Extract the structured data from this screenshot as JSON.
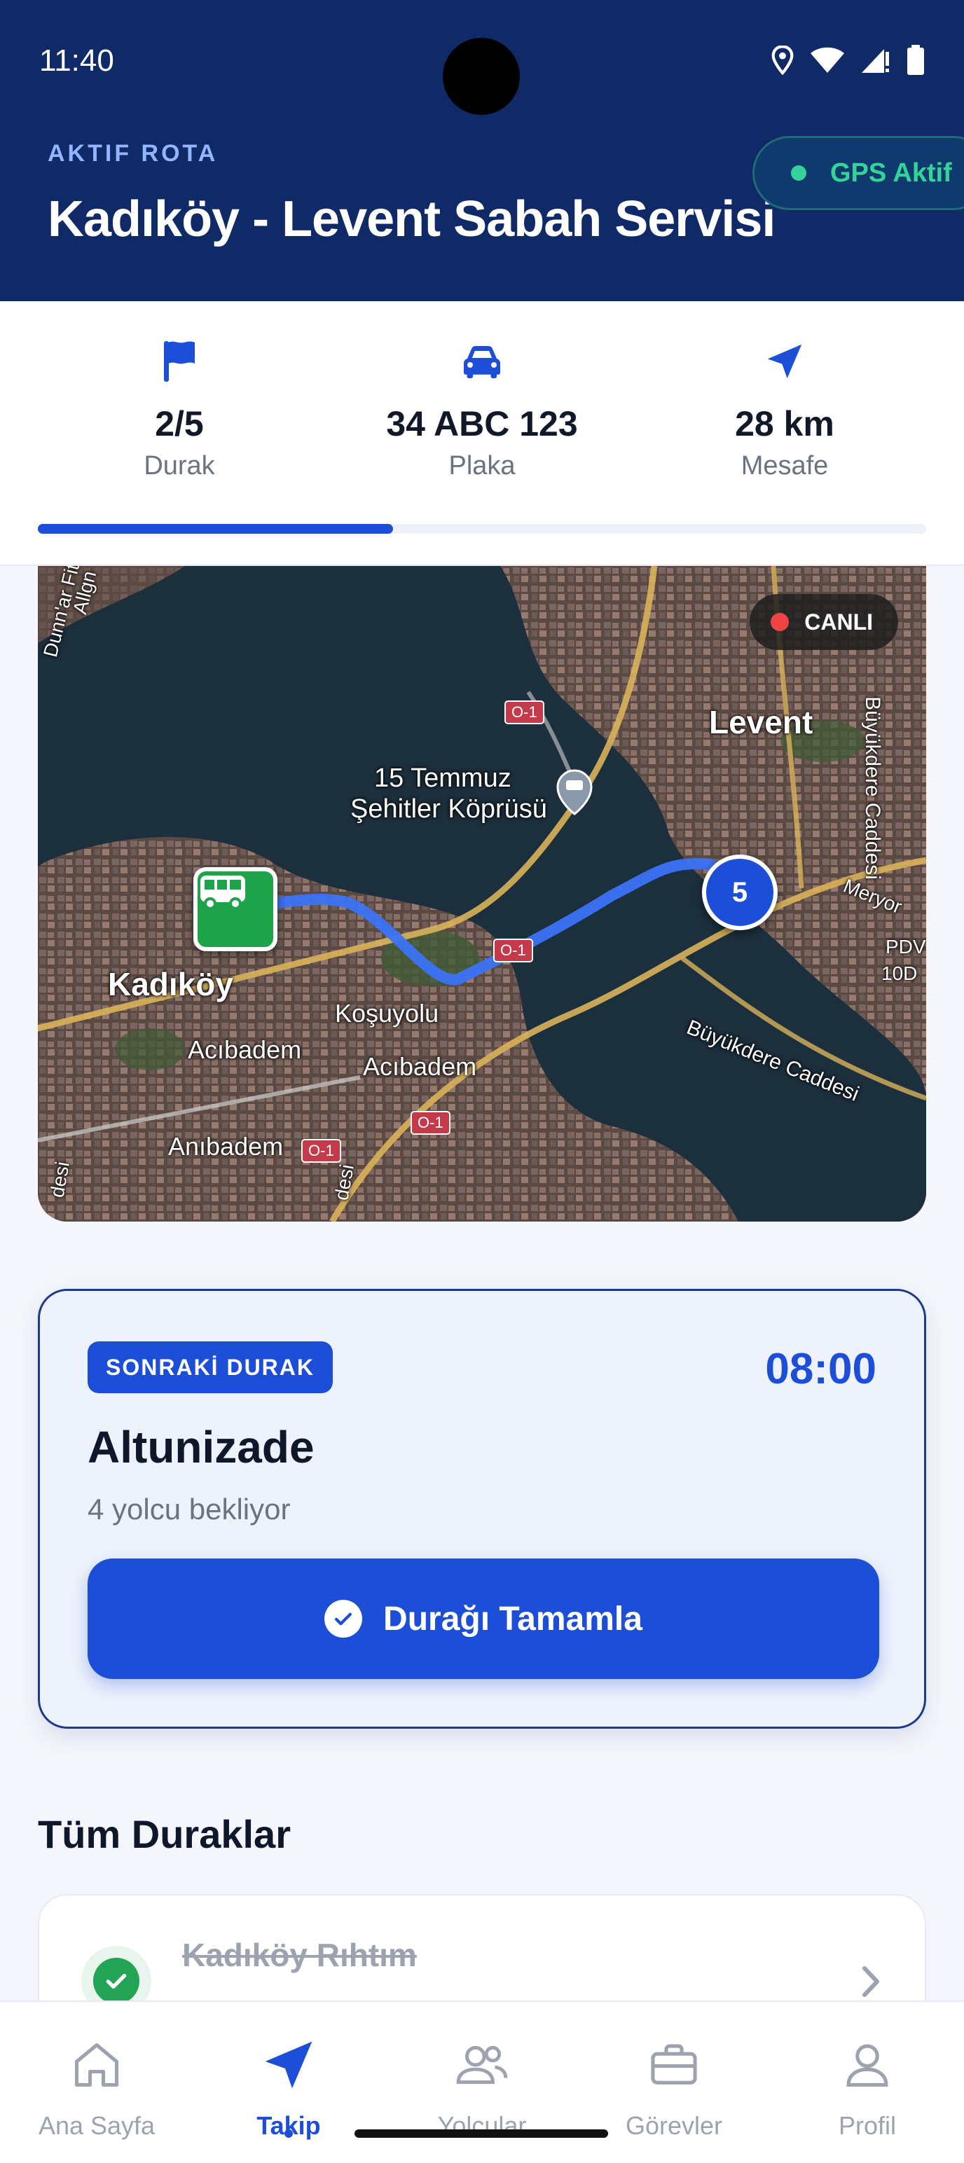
{
  "status_bar": {
    "time": "11:40"
  },
  "header": {
    "eyebrow": "AKTIF ROTA",
    "title": "Kadıköy - Levent Sabah Servisi",
    "gps_status": "GPS Aktif"
  },
  "stats": [
    {
      "icon": "flag-icon",
      "value": "2/5",
      "label": "Durak"
    },
    {
      "icon": "car-icon",
      "value": "34 ABC 123",
      "label": "Plaka"
    },
    {
      "icon": "navigation-arrow-icon",
      "value": "28 km",
      "label": "Mesafe"
    }
  ],
  "route_progress": 0.4,
  "map": {
    "live_label": "CANLI",
    "stop_marker_number": "5",
    "labels": {
      "levent": "Levent",
      "bridge_line1": "15 Temmuz",
      "bridge_line2": "Şehitler Köprüsü",
      "kadikoy": "Kadıköy",
      "kosuyolu": "Koşuyolu",
      "acibadem1": "Acıbadem",
      "acibadem2": "Acıbadem",
      "anibadem": "Anıbadem",
      "buyukdere_vertical": "Büyükdere Caddesi",
      "buyukdere_diag": "Büyükdere Caddesi",
      "meryor": "Meryor",
      "pdv": "PDV",
      "tenod": "10D",
      "top_left1": "Dunn'ar Fitn",
      "top_left2": "Allgn",
      "bottom_left": "desi",
      "bottom_mid": "desi"
    },
    "road_tags": [
      "O-1",
      "O-1",
      "O-1",
      "O-1"
    ]
  },
  "next_stop": {
    "badge": "SONRAKİ DURAK",
    "time": "08:00",
    "name": "Altunizade",
    "subtitle": "4 yolcu bekliyor",
    "button_label": "Durağı Tamamla"
  },
  "all_stops": {
    "title": "Tüm Duraklar",
    "items": [
      {
        "name": "Kadıköy Rıhtım",
        "status": "completed"
      }
    ]
  },
  "bottom_nav": [
    {
      "icon": "home-icon",
      "label": "Ana Sayfa",
      "active": false
    },
    {
      "icon": "navigation-icon",
      "label": "Takip",
      "active": true
    },
    {
      "icon": "users-icon",
      "label": "Yolcular",
      "active": false
    },
    {
      "icon": "briefcase-icon",
      "label": "Görevler",
      "active": false
    },
    {
      "icon": "user-icon",
      "label": "Profil",
      "active": false
    }
  ],
  "colors": {
    "header_bg": "#0f2a66",
    "accent": "#1d4ed8",
    "success": "#22a355",
    "gps_green": "#34d399",
    "live_red": "#ef4444"
  }
}
